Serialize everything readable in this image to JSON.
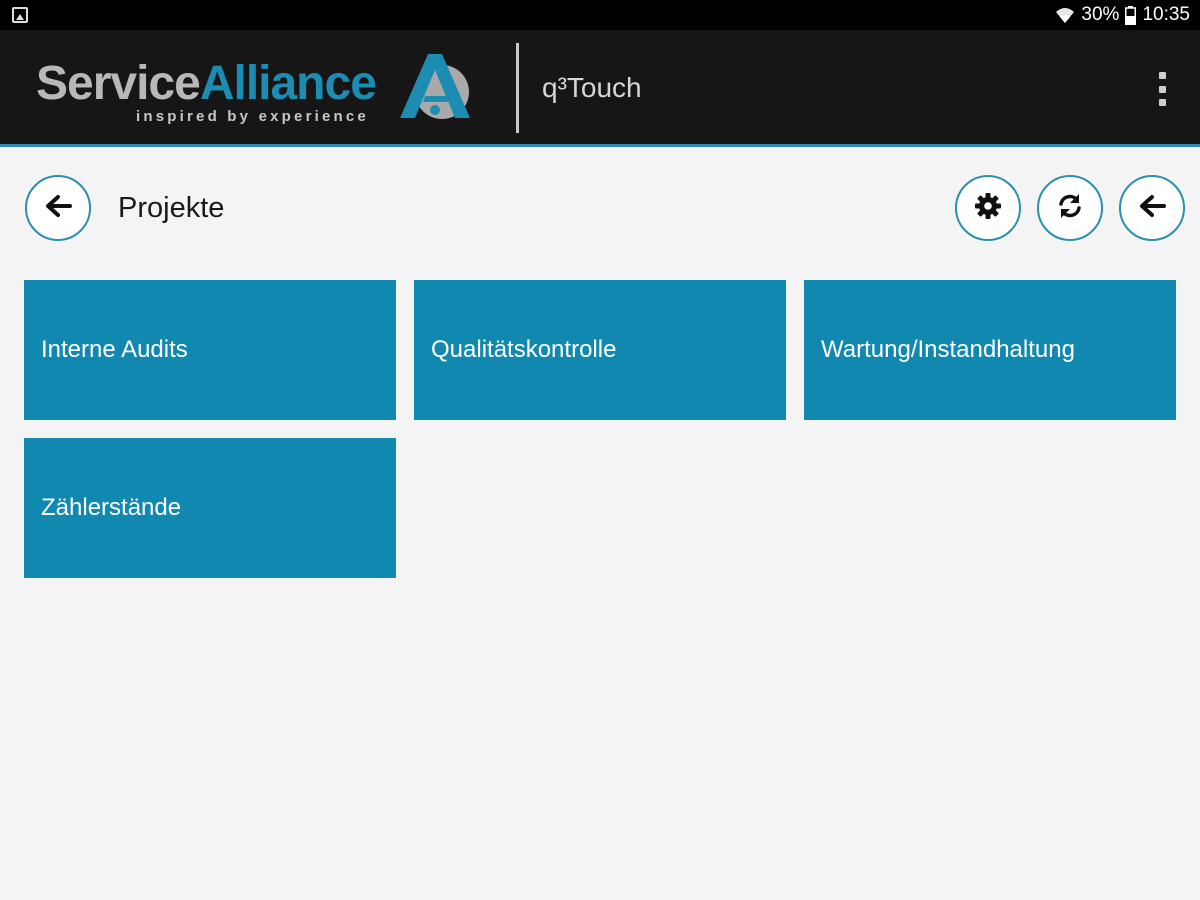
{
  "status_bar": {
    "battery_percent": "30%",
    "time": "10:35",
    "icons": [
      "gallery-icon",
      "wifi-icon",
      "battery-icon"
    ]
  },
  "app_bar": {
    "logo_word_1": "Service",
    "logo_word_2": "Alliance",
    "logo_tagline": "inspired by experience",
    "app_name": "q³Touch",
    "menu_icon": "overflow-menu-icon"
  },
  "header": {
    "title": "Projekte",
    "back_icon": "arrow-left-icon",
    "actions": [
      "gear-icon",
      "refresh-icon",
      "arrow-left-icon"
    ]
  },
  "tiles": [
    {
      "label": "Interne Audits"
    },
    {
      "label": "Qualitätskontrolle"
    },
    {
      "label": "Wartung/Instandhaltung"
    },
    {
      "label": "Zählerstände"
    }
  ],
  "colors": {
    "accent": "#2a8fb0",
    "tile": "#1188b0",
    "appbar": "#161616",
    "background": "#f4f4f4"
  }
}
